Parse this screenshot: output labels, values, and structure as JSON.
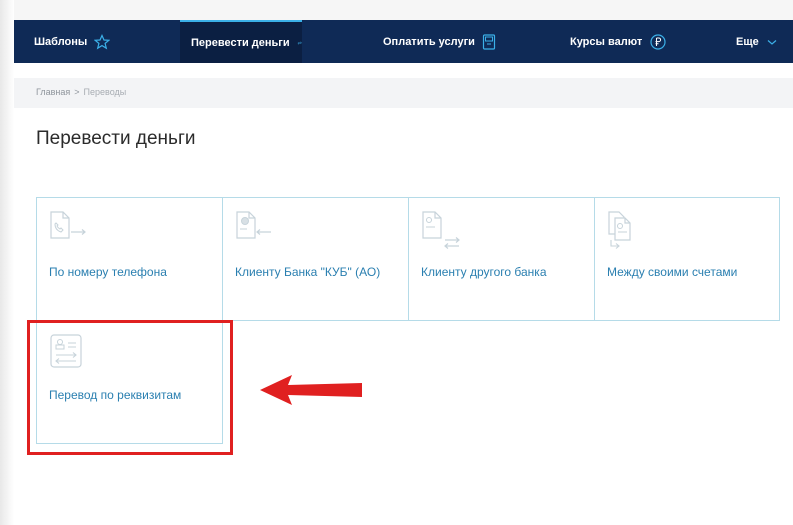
{
  "nav": {
    "templates": "Шаблоны",
    "transfer": "Перевести деньги",
    "pay": "Оплатить услуги",
    "rates": "Курсы валют",
    "more": "Еще"
  },
  "breadcrumb": {
    "home": "Главная",
    "separator": ">",
    "current": "Переводы"
  },
  "page_title": "Перевести деньги",
  "cards": [
    {
      "label": "По номеру телефона",
      "icon": "phone-transfer-icon"
    },
    {
      "label": "Клиенту Банка \"КУБ\" (АО)",
      "icon": "bank-client-icon"
    },
    {
      "label": "Клиенту другого банка",
      "icon": "other-bank-icon"
    },
    {
      "label": "Между своими счетами",
      "icon": "own-accounts-icon"
    },
    {
      "label": "Перевод по реквизитам",
      "icon": "requisites-icon"
    }
  ],
  "colors": {
    "nav_bg": "#0f2a56",
    "accent": "#3bb0e8",
    "card_border": "#b5dbe8",
    "card_text": "#2a7fb0",
    "highlight": "#e02020"
  }
}
